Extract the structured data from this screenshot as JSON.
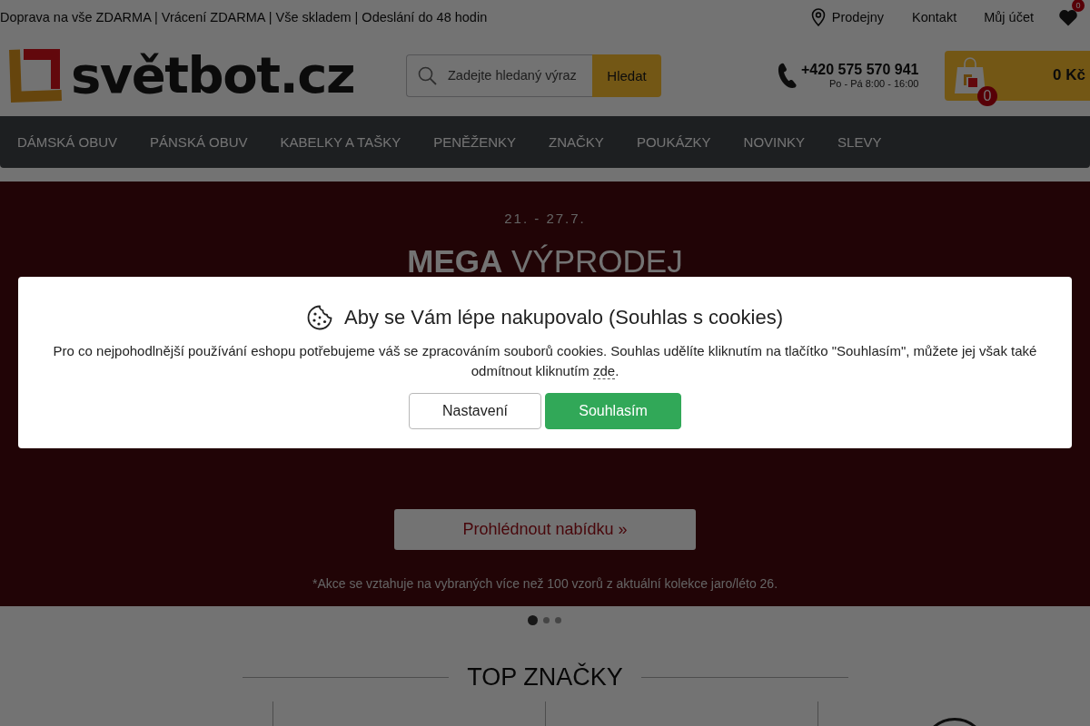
{
  "top_bar": {
    "benefits": "Doprava na vše ZDARMA | Vrácení ZDARMA | Vše skladem | Odeslání do 48 hodin",
    "store_link": "Prodejny",
    "links": [
      "Kontakt",
      "Můj účet"
    ],
    "wishlist_count": "0"
  },
  "header": {
    "logo": "světbot.cz",
    "search": {
      "placeholder": "Zadejte hledaný výraz",
      "button": "Hledat"
    },
    "phone": {
      "number": "+420 575 570 941",
      "hours": "Po - Pá 8:00 - 16:00"
    },
    "cart": {
      "count": "0",
      "total": "0 Kč"
    }
  },
  "nav": [
    "DÁMSKÁ OBUV",
    "PÁNSKÁ OBUV",
    "KABELKY A TAŠKY",
    "PENĚŽENKY",
    "ZNAČKY",
    "POUKÁZKY",
    "NOVINKY",
    "SLEVY"
  ],
  "hero": {
    "dates": "21. - 27.7.",
    "title": "**MEGA** VÝPRODEJ",
    "button": "Prohlédnout nabídku »",
    "footnote": "*Akce se vztahuje na vybraných více než 100 vzorů z aktuální kolekce jaro/léto 26.",
    "slides": [
      {
        "selected": true
      },
      {
        "selected": false
      },
      {
        "selected": false
      }
    ]
  },
  "brands": {
    "title": "TOP ZNAČKY"
  },
  "cookie_dialog": {
    "title": "Aby se Vám lépe nakupovalo (Souhlas s cookies)",
    "text": "Pro co nejpohodlnější používání eshopu potřebujeme váš se zpracováním souborů cookies. Souhlas udělíte kliknutím na tlačítko \"Souhlasím\", můžete jej však také odmítnout kliknutím",
    "link": "zde",
    "text_end": ".",
    "buttons": [
      {
        "kind": "secondary",
        "label": "Nastavení"
      },
      {
        "kind": "primary",
        "label": "Souhlasím"
      }
    ]
  }
}
